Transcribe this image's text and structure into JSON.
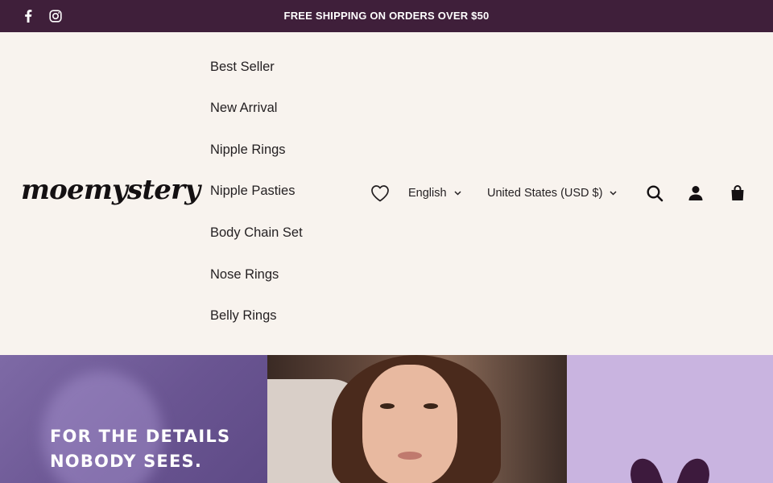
{
  "announcement": {
    "text": "FREE SHIPPING ON ORDERS OVER $50",
    "background": "#3f1f3a",
    "social_icons": [
      "facebook-icon",
      "instagram-icon"
    ]
  },
  "header": {
    "logo": "moemystery",
    "nav": [
      {
        "label": "Best Seller"
      },
      {
        "label": "New Arrival"
      },
      {
        "label": "Nipple Rings"
      },
      {
        "label": "Nipple Pasties"
      },
      {
        "label": "Body Chain Set"
      },
      {
        "label": "Nose Rings"
      },
      {
        "label": "Belly Rings"
      }
    ],
    "language": "English",
    "country": "United States (USD $)",
    "icons": [
      "heart-icon",
      "search-icon",
      "account-icon",
      "cart-icon"
    ]
  },
  "hero": {
    "headline_line1": "FOR THE DETAILS",
    "headline_line2": "NOBODY SEES."
  }
}
